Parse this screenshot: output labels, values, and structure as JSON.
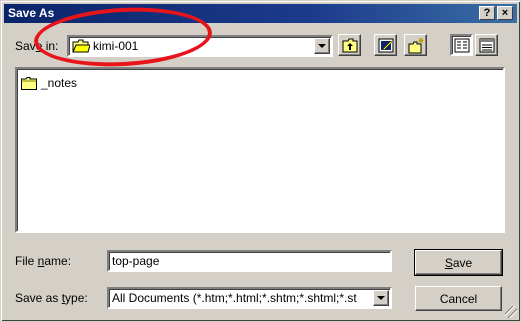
{
  "dialog": {
    "title": "Save As",
    "help_label": "?",
    "close_label": "×"
  },
  "save_in": {
    "label_pre": "Sav",
    "label_ul": "e",
    "label_post": " in:",
    "value": "kimi-001"
  },
  "toolbar": {
    "icons": [
      "up-one-level-icon",
      "desktop-icon",
      "new-folder-icon",
      "list-view-icon",
      "details-view-icon"
    ]
  },
  "files": [
    {
      "name": "_notes",
      "icon": "folder-icon"
    }
  ],
  "file_name": {
    "label_pre": "File ",
    "label_ul": "n",
    "label_post": "ame:",
    "value": "top-page"
  },
  "save_as_type": {
    "label_pre": "Save as ",
    "label_ul": "t",
    "label_post": "ype:",
    "value": "All Documents (*.htm;*.html;*.shtm;*.shtml;*.st"
  },
  "buttons": {
    "save_ul": "S",
    "save_rest": "ave",
    "cancel": "Cancel"
  },
  "colors": {
    "annotation": "#e8141b",
    "titlebar": "#0a246a",
    "face": "#d4d0c8"
  }
}
